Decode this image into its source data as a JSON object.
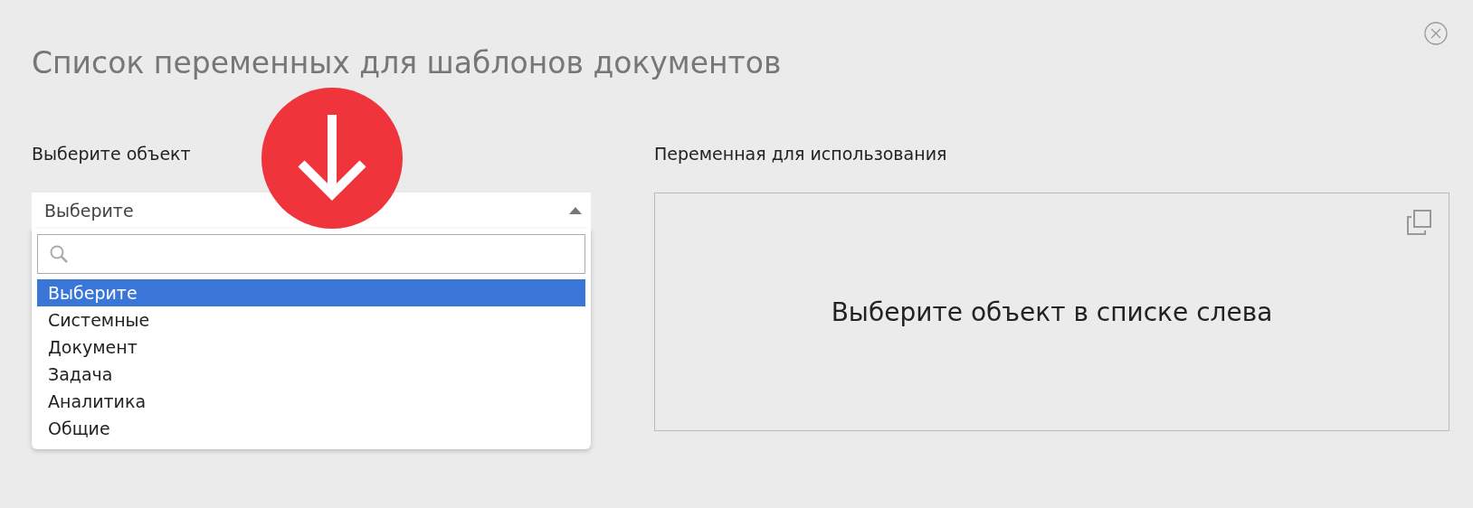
{
  "dialog": {
    "title": "Список переменных для шаблонов документов"
  },
  "object_picker": {
    "label": "Выберите объект",
    "value": "Выберите",
    "expanded": true,
    "options": [
      {
        "label": "Выберите",
        "selected": true
      },
      {
        "label": "Системные",
        "selected": false
      },
      {
        "label": "Документ",
        "selected": false
      },
      {
        "label": "Задача",
        "selected": false
      },
      {
        "label": "Аналитика",
        "selected": false
      },
      {
        "label": "Общие",
        "selected": false
      }
    ]
  },
  "variable_panel": {
    "label": "Переменная для использования",
    "message": "Выберите объект в списке слева"
  }
}
